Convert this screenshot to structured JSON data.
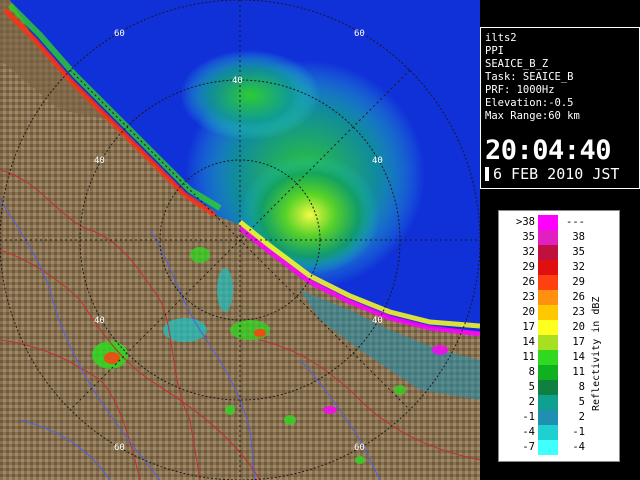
{
  "radar": {
    "range_rings": [
      {
        "label": "60"
      },
      {
        "label": "60"
      },
      {
        "label": "40"
      },
      {
        "label": "40"
      },
      {
        "label": "40"
      },
      {
        "label": "40"
      },
      {
        "label": "40"
      },
      {
        "label": "60"
      },
      {
        "label": "60"
      }
    ]
  },
  "info": {
    "site": "ilts2",
    "scan_type": "PPI",
    "product": "SEAICE_B_Z",
    "task": "Task: SEAICE_B",
    "prf": "PRF: 1000Hz",
    "elevation": "Elevation:-0.5",
    "max_range": "Max Range:60 km",
    "time": "20:04:40",
    "date": "6 FEB 2010 JST"
  },
  "legend": {
    "unit_label": "Reflectivity in dBZ",
    "rows": [
      {
        "lo": ">38",
        "hi": "---",
        "color": "#ff00ff"
      },
      {
        "lo": "35",
        "hi": "38",
        "color": "#e020c0"
      },
      {
        "lo": "32",
        "hi": "35",
        "color": "#c01040"
      },
      {
        "lo": "29",
        "hi": "32",
        "color": "#e01010"
      },
      {
        "lo": "26",
        "hi": "29",
        "color": "#ff4010"
      },
      {
        "lo": "23",
        "hi": "26",
        "color": "#ff9010"
      },
      {
        "lo": "20",
        "hi": "23",
        "color": "#ffc800"
      },
      {
        "lo": "17",
        "hi": "20",
        "color": "#ffff20"
      },
      {
        "lo": "14",
        "hi": "17",
        "color": "#a8e020"
      },
      {
        "lo": "11",
        "hi": "14",
        "color": "#30d820"
      },
      {
        "lo": "8",
        "hi": "11",
        "color": "#10b020"
      },
      {
        "lo": "5",
        "hi": "8",
        "color": "#108040"
      },
      {
        "lo": "2",
        "hi": "5",
        "color": "#10a090"
      },
      {
        "lo": "-1",
        "hi": "2",
        "color": "#2090b0"
      },
      {
        "lo": "-4",
        "hi": "-1",
        "color": "#20d0d0"
      },
      {
        "lo": "-7",
        "hi": "-4",
        "color": "#40ffff"
      }
    ]
  },
  "colors": {
    "sea": "#1030d8",
    "land": "#8a7050",
    "ring": "#1a1a1a",
    "border_red": "#c03030",
    "border_blue": "#5060e0"
  }
}
